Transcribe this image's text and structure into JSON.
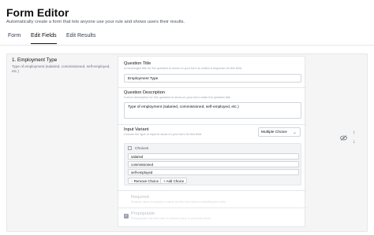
{
  "header": {
    "title": "Form Editor",
    "subtitle": "Automatically create a form that lets anyone use your rule and shows users their results."
  },
  "tabs": [
    {
      "label": "Form"
    },
    {
      "label": "Edit Fields"
    },
    {
      "label": "Edit Results"
    }
  ],
  "section": {
    "title": "1. Employment Type",
    "description": "Type of employment (salaried, commissioned, self-employed, etc.)"
  },
  "question_title": {
    "label": "Question Title",
    "help": "A meaningful title for the question to show on your form to collect a response for this field",
    "value": "Employment Type"
  },
  "question_description": {
    "label": "Question Description",
    "help": "A short description for this question to show on your form under the question title",
    "value": "Type of employment (salaried, commissioned, self-employed, etc.)"
  },
  "input_variant": {
    "label": "Input Variant",
    "help": "Choose the type of input to show on your form for this field",
    "selected": "Multiple Choice",
    "chevron": "chevron-down-icon"
  },
  "choices": {
    "heading": "Choices",
    "items": [
      "salaried",
      "commissioned",
      "self-employed"
    ],
    "remove_label": "Remove Choice",
    "add_label": "+ Add Choice"
  },
  "required": {
    "label": "Required",
    "help": "Require users to provide a value for this field before submitting the form"
  },
  "prepopulate": {
    "label": "Prepopulate",
    "help": "Prepopulate this field with its default value or previous result"
  },
  "side_icons": [
    "eye-off-icon",
    "arrow-up-icon",
    "arrow-down-icon"
  ]
}
